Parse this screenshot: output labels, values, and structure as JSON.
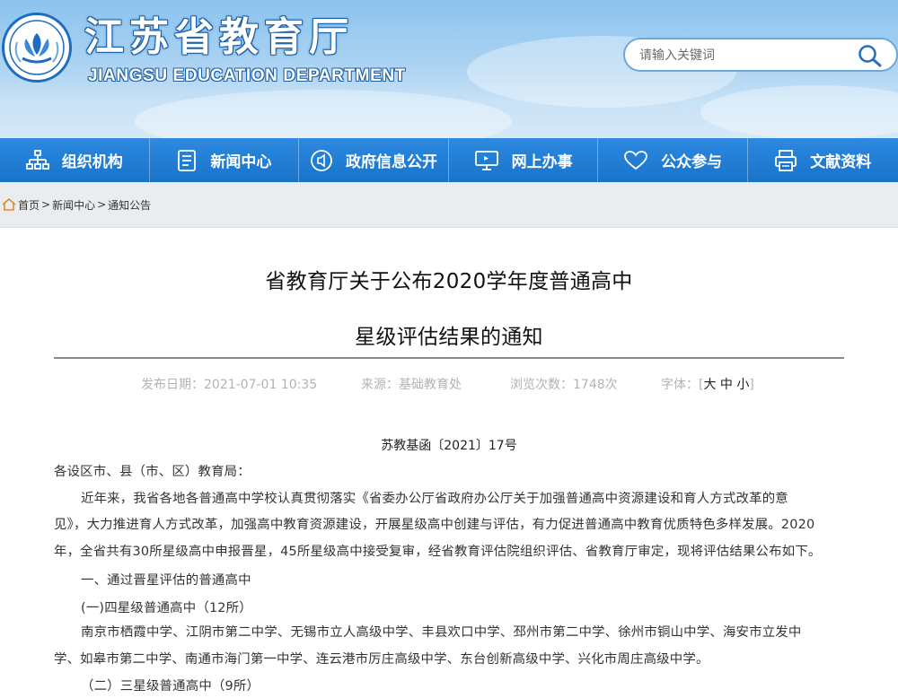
{
  "header": {
    "title": "江苏省教育厅",
    "subtitle": "JIANGSU EDUCATION DEPARTMENT",
    "search_placeholder": "请输入关键词"
  },
  "nav": [
    {
      "label": "组织机构",
      "icon": "org-chart-icon"
    },
    {
      "label": "新闻中心",
      "icon": "document-icon"
    },
    {
      "label": "政府信息公开",
      "icon": "speaker-icon"
    },
    {
      "label": "网上办事",
      "icon": "monitor-icon"
    },
    {
      "label": "公众参与",
      "icon": "heart-icon"
    },
    {
      "label": "文献资料",
      "icon": "printer-icon"
    }
  ],
  "breadcrumb": {
    "home": "首页",
    "sep": ">",
    "news": "新闻中心",
    "current": "通知公告"
  },
  "article": {
    "title_line1": "省教育厅关于公布2020学年度普通高中",
    "title_line2": "星级评估结果的通知",
    "publish_date": "发布日期：2021-07-01 10:35",
    "source": "来源：基础教育处",
    "views": "浏览次数：1748次",
    "font_label": "字体：[",
    "font_large": "大",
    "font_medium": "中",
    "font_small": "小",
    "font_close": "]",
    "doc_number": "苏教基函〔2021〕17号",
    "salutation": "各设区市、县（市、区）教育局：",
    "p1_line1": "近年来，我省各地各普通高中学校认真贯彻落实《省委办公厅省政府办公厅关于加强普通高中资源建设和育人方式改革的意",
    "p1_line2": "见》，大力推进育人方式改革，加强高中教育资源建设，开展星级高中创建与评估，有力促进普通高中教育优质特色多样发展。2020",
    "p1_line3": "年，全省共有30所星级高中申报晋星，45所星级高中接受复审，经省教育评估院组织评估、省教育厅审定，现将评估结果公布如下。",
    "section1": "一、通过晋星评估的普通高中",
    "sub1": "(一)四星级普通高中（12所）",
    "list1_line1": "南京市栖霞中学、江阴市第二中学、无锡市立人高级中学、丰县欢口中学、邳州市第二中学、徐州市铜山中学、海安市立发中",
    "list1_line2": "学、如皋市第二中学、南通市海门第一中学、连云港市厉庄高级中学、东台创新高级中学、兴化市周庄高级中学。",
    "sub2": "（二）三星级普通高中（9所）"
  }
}
